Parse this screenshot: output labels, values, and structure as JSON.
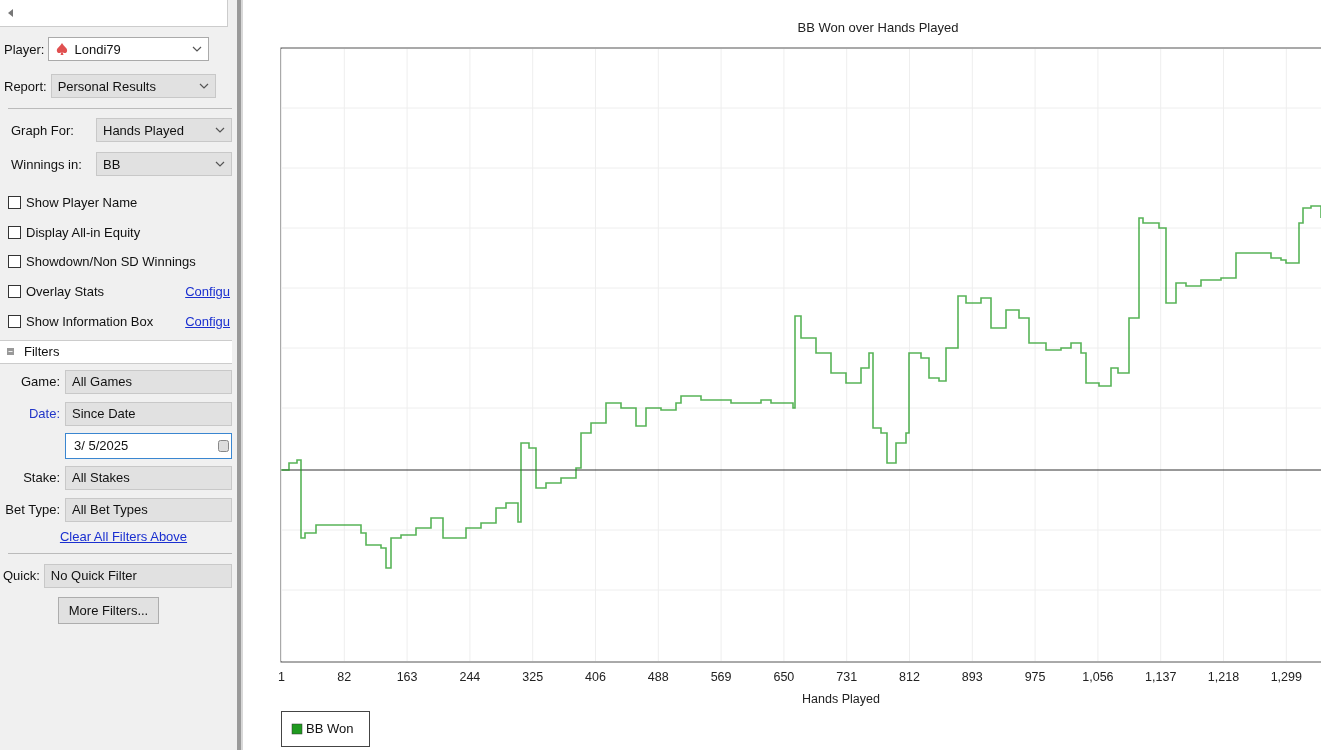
{
  "player": {
    "label": "Player:",
    "value": "Londi79"
  },
  "report": {
    "label": "Report:",
    "value": "Personal Results"
  },
  "graph_options": [
    {
      "label": "Graph For:",
      "value": "Hands Played"
    },
    {
      "label": "Winnings in:",
      "value": "BB"
    }
  ],
  "options": [
    {
      "label": "Show Player Name",
      "checked": false
    },
    {
      "label": "Display All-in Equity",
      "checked": false
    },
    {
      "label": "Showdown/Non SD Winnings",
      "checked": false
    },
    {
      "label": "Overlay Stats",
      "checked": false,
      "link": "Configu"
    },
    {
      "label": "Show Information Box",
      "checked": false,
      "link": "Configu"
    }
  ],
  "filters": {
    "title": "Filters",
    "fields": [
      {
        "kind": "select",
        "label": "Game:",
        "value": "All Games",
        "active": false
      },
      {
        "kind": "select",
        "label": "Date:",
        "value": "Since Date",
        "active": true
      },
      {
        "kind": "date",
        "value": "3/  5/2025"
      },
      {
        "kind": "select",
        "label": "Stake:",
        "value": "All Stakes",
        "active": false
      },
      {
        "kind": "select",
        "label": "Bet Type:",
        "value": "All Bet Types",
        "active": false
      }
    ],
    "clear_link": "Clear All Filters Above"
  },
  "quick": {
    "label": "Quick:",
    "value": "No Quick Filter"
  },
  "more_filters_button": "More Filters...",
  "chart": {
    "title": "BB Won over Hands Played",
    "xlabel": "Hands Played",
    "xticks": [
      "1",
      "82",
      "163",
      "244",
      "325",
      "406",
      "488",
      "569",
      "650",
      "731",
      "812",
      "893",
      "975",
      "1,056",
      "1,137",
      "1,218",
      "1,299"
    ],
    "legend": [
      {
        "label": "BB Won",
        "color": "#1f9a1f"
      }
    ]
  }
}
